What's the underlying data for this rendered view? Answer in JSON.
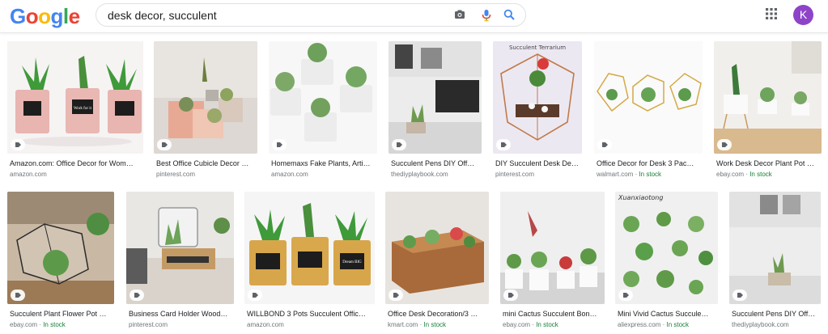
{
  "logo": [
    "G",
    "o",
    "o",
    "g",
    "l",
    "e"
  ],
  "logo_colors": [
    "#4285F4",
    "#EA4335",
    "#FBBC05",
    "#4285F4",
    "#34A853",
    "#EA4335"
  ],
  "search": {
    "query": "desk decor, succulent"
  },
  "user": {
    "initial": "K"
  },
  "row1": [
    {
      "title": "Amazon.com: Office Decor for Wom…",
      "source": "amazon.com",
      "stock": ""
    },
    {
      "title": "Best Office Cubicle Decor …",
      "source": "pinterest.com",
      "stock": ""
    },
    {
      "title": "Homemaxs Fake Plants, Arti…",
      "source": "amazon.com",
      "stock": ""
    },
    {
      "title": "Succulent Pens DIY Off…",
      "source": "thediyplaybook.com",
      "stock": ""
    },
    {
      "title": "DIY Succulent Desk De…",
      "source": "pinterest.com",
      "stock": ""
    },
    {
      "title": "Office Decor for Desk 3 Pac…",
      "source": "walmart.com",
      "stock": "In stock"
    },
    {
      "title": "Work Desk Decor Plant Pot …",
      "source": "ebay.com",
      "stock": "In stock"
    }
  ],
  "row2": [
    {
      "title": "Succulent Plant Flower Pot …",
      "source": "ebay.com",
      "stock": "In stock"
    },
    {
      "title": "Business Card Holder Wood…",
      "source": "pinterest.com",
      "stock": ""
    },
    {
      "title": "WILLBOND 3 Pots Succulent Offic…",
      "source": "amazon.com",
      "stock": ""
    },
    {
      "title": "Office Desk Decoration/3 …",
      "source": "kmart.com",
      "stock": "In stock"
    },
    {
      "title": "mini Cactus Succulent Bon…",
      "source": "ebay.com",
      "stock": "In stock"
    },
    {
      "title": "Mini Vivid Cactus Succule…",
      "source": "aliexpress.com",
      "stock": "In stock"
    },
    {
      "title": "Succulent Pens DIY Off…",
      "source": "thediyplaybook.com",
      "stock": ""
    }
  ],
  "image_text": {
    "terrarium_caption": "Succulent Terrarium",
    "brand_watermark": "Xuanxiaotong",
    "pot_label_1": "Work for it",
    "pot_label_2": "Dream BIG"
  },
  "separator": " · ",
  "colors": {
    "stock_green": "#188038",
    "meta_gray": "#70757a",
    "avatar_purple": "#8e44c8"
  }
}
